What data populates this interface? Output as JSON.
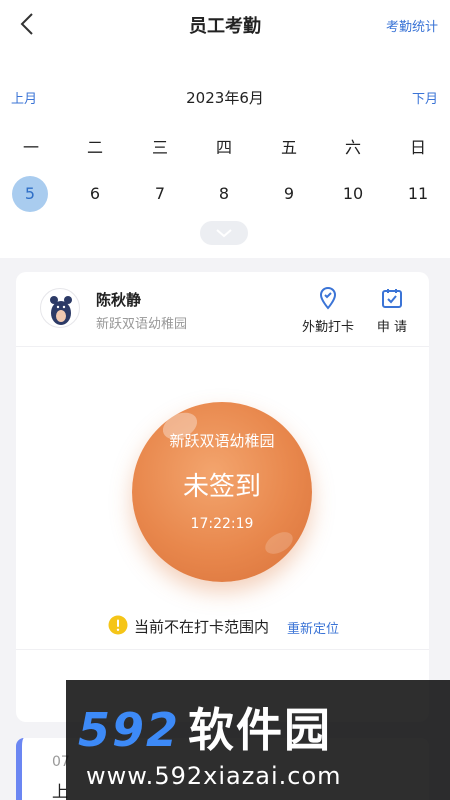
{
  "header": {
    "title": "员工考勤",
    "stats_link": "考勤统计"
  },
  "calendar": {
    "prev_label": "上月",
    "next_label": "下月",
    "month_label": "2023年6月",
    "weekdays": [
      "一",
      "二",
      "三",
      "四",
      "五",
      "六",
      "日"
    ],
    "days": [
      "5",
      "6",
      "7",
      "8",
      "9",
      "10",
      "11"
    ],
    "selected_day": "5"
  },
  "card": {
    "user_name": "陈秋静",
    "school": "新跃双语幼稚园",
    "actions": {
      "field_checkin": "外勤打卡",
      "apply": "申 请"
    },
    "checkin_button": {
      "school": "新跃双语幼稚园",
      "status": "未签到",
      "time": "17:22:19"
    },
    "location_notice": "当前不在打卡范围内",
    "relocate": "重新定位"
  },
  "record": {
    "time": "07",
    "label": "上"
  },
  "watermark": {
    "logo": "592",
    "logo_cn": "软件园",
    "url": "www.592xiazai.com"
  },
  "colors": {
    "accent": "#3b74d6",
    "checkin_orange": "#e8874c",
    "selected_day_bg": "#a9ccef",
    "record_bar": "#6b86f2"
  }
}
